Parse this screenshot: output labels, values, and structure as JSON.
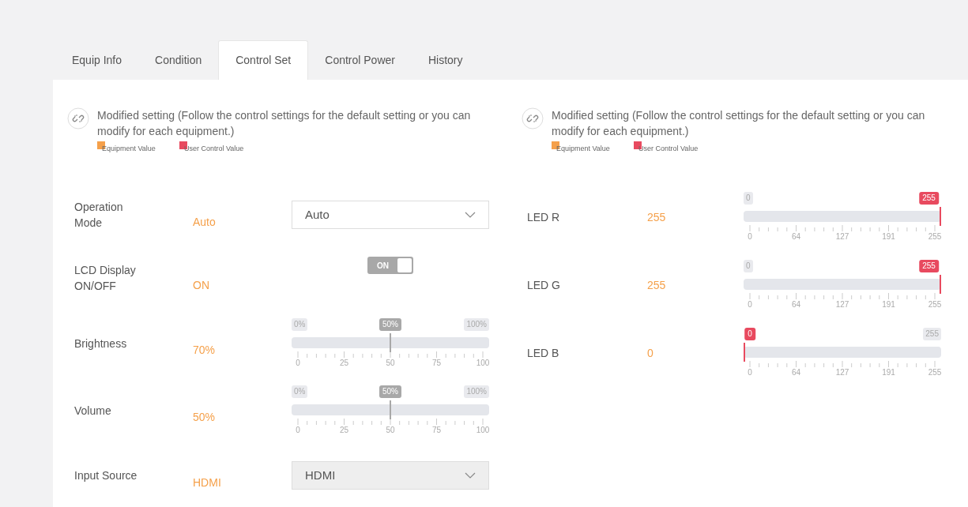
{
  "tabs": [
    {
      "label": "Equip Info",
      "selected": false
    },
    {
      "label": "Condition",
      "selected": false
    },
    {
      "label": "Control Set",
      "selected": true
    },
    {
      "label": "Control Power",
      "selected": false
    },
    {
      "label": "History",
      "selected": false
    }
  ],
  "columns": [
    {
      "note": "Modified setting (Follow the control settings for the default setting or you can modify for each equipment.)",
      "legend": [
        {
          "label": "Equipment Value",
          "color": "#f5a04a"
        },
        {
          "label": "User Control Value",
          "color": "#e84a5f"
        }
      ],
      "rows": [
        {
          "kind": "select",
          "label": "Operation Mode",
          "value": "Auto",
          "control": {
            "value": "Auto",
            "disabled": false
          }
        },
        {
          "kind": "toggle",
          "label": "LCD Display ON/OFF",
          "value": "ON",
          "control": {
            "text": "ON",
            "on": true,
            "disabled": true
          }
        },
        {
          "kind": "slider",
          "label": "Brightness",
          "value": "70%",
          "control": {
            "level": 0.5,
            "min_label": "0%",
            "max_label": "100%",
            "bubble": "50%",
            "disabled": true,
            "ticks": [
              "0",
              "25",
              "50",
              "75",
              "100"
            ]
          }
        },
        {
          "kind": "slider",
          "label": "Volume",
          "value": "50%",
          "control": {
            "level": 0.5,
            "min_label": "0%",
            "max_label": "100%",
            "bubble": "50%",
            "disabled": true,
            "ticks": [
              "0",
              "25",
              "50",
              "75",
              "100"
            ]
          }
        },
        {
          "kind": "select",
          "label": "Input Source",
          "value": "HDMI",
          "control": {
            "value": "HDMI",
            "disabled": true
          }
        }
      ]
    },
    {
      "note": "Modified setting (Follow the control settings for the default setting or you can modify for each equipment.)",
      "legend": [
        {
          "label": "Equipment Value",
          "color": "#f5a04a"
        },
        {
          "label": "User Control Value",
          "color": "#e84a5f"
        }
      ],
      "rows": [
        {
          "kind": "slider",
          "label": "LED R",
          "value": "255",
          "control": {
            "level": 1,
            "min_label": "0",
            "bubble": "255",
            "disabled": false,
            "ticks": [
              "0",
              "64",
              "127",
              "191",
              "255"
            ]
          }
        },
        {
          "kind": "slider",
          "label": "LED G",
          "value": "255",
          "control": {
            "level": 1,
            "min_label": "0",
            "bubble": "255",
            "disabled": false,
            "ticks": [
              "0",
              "64",
              "127",
              "191",
              "255"
            ]
          }
        },
        {
          "kind": "slider",
          "label": "LED B",
          "value": "0",
          "control": {
            "level": 0,
            "max_label": "255",
            "bubble": "0",
            "disabled": false,
            "ticks": [
              "0",
              "64",
              "127",
              "191",
              "255"
            ]
          }
        }
      ]
    }
  ]
}
